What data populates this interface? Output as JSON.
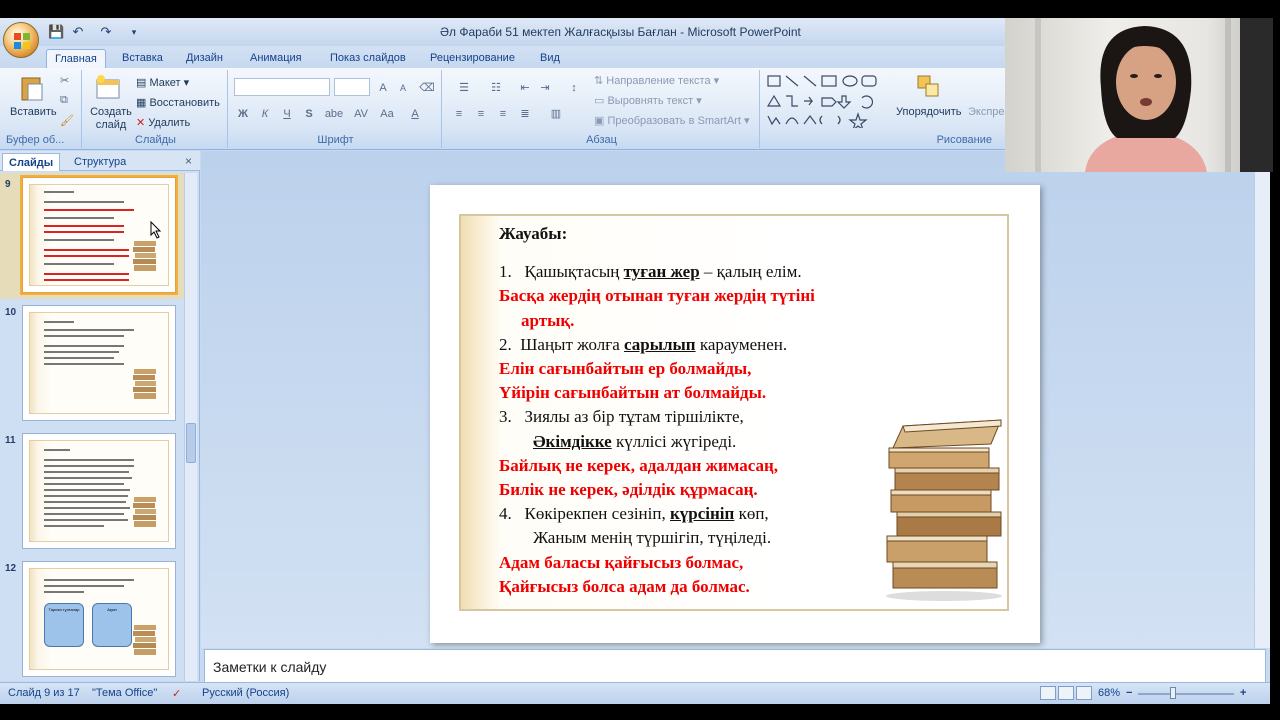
{
  "window": {
    "title": "Әл Фараби 51 мектеп Жалғасқызы Бағлан - Microsoft PowerPoint"
  },
  "ribbon_tabs": [
    "Главная",
    "Вставка",
    "Дизайн",
    "Анимация",
    "Показ слайдов",
    "Рецензирование",
    "Вид"
  ],
  "ribbon": {
    "clipboard": {
      "paste": "Вставить",
      "label": "Буфер об..."
    },
    "slides": {
      "new_slide": "Создать слайд",
      "layout": "Макет",
      "reset": "Восстановить",
      "delete": "Удалить",
      "label": "Слайды"
    },
    "font": {
      "grow": "A",
      "shrink": "A",
      "bold": "Ж",
      "italic": "К",
      "underline": "Ч",
      "strike": "S",
      "shadow": "abe",
      "spacing": "AV",
      "case": "Aa",
      "color": "A",
      "label": "Шрифт"
    },
    "paragraph": {
      "direction": "Направление текста",
      "align": "Выровнять текст",
      "smartart": "Преобразовать в SmartArt",
      "label": "Абзац"
    },
    "drawing": {
      "arrange": "Упорядочить",
      "quick_styles": "Экспрес",
      "label": "Рисование"
    }
  },
  "left_panel": {
    "tabs": [
      "Слайды",
      "Структура"
    ],
    "close": "×",
    "thumbnails": [
      {
        "number": "9",
        "selected": true
      },
      {
        "number": "10",
        "selected": false
      },
      {
        "number": "11",
        "selected": false
      },
      {
        "number": "12",
        "selected": false
      }
    ],
    "thumb_box_labels": [
      "Тарихи тұлғалар",
      "Ақын"
    ]
  },
  "slide": {
    "heading": "Жауабы:",
    "items": [
      {
        "num": "1.",
        "pre": "Қашықтасың ",
        "ul": "туған жер",
        "post": " – қалың елім."
      },
      {
        "red": [
          "Басқа жердің отынан туған жердің түтіні",
          "артық."
        ]
      },
      {
        "num": "2.",
        "pre": "Шаңыт жолға ",
        "ul": "сарылып",
        "post": " карауменен."
      },
      {
        "red": [
          "Елін сағынбайтын ер болмайды,",
          "Үйірін сағынбайтын ат болмайды."
        ]
      },
      {
        "num": "3.",
        "pre": "Зиялы аз бір тұтам тіршілікте,",
        "ul2": "Әкімдікке",
        "post2": " күллісі жүгіреді."
      },
      {
        "red": [
          "Байлық не керек, адалдан жимасаң,",
          "Билік не керек, әділдік құрмасаң."
        ]
      },
      {
        "num": "4.",
        "pre": "Көкірекпен сезініп, ",
        "ul": "күрсініп",
        "post": " көп,",
        "line2": "Жаным менің түршігіп, түңіледі."
      },
      {
        "red": [
          "Адам баласы қайғысыз болмас,",
          "Қайғысыз болса адам да болмас."
        ]
      }
    ]
  },
  "notes": {
    "placeholder": "Заметки к слайду"
  },
  "statusbar": {
    "slide_info": "Слайд 9 из 17",
    "theme": "\"Тема Office\"",
    "language": "Русский (Россия)",
    "zoom": "68%",
    "zoom_minus": "−",
    "zoom_plus": "+"
  }
}
